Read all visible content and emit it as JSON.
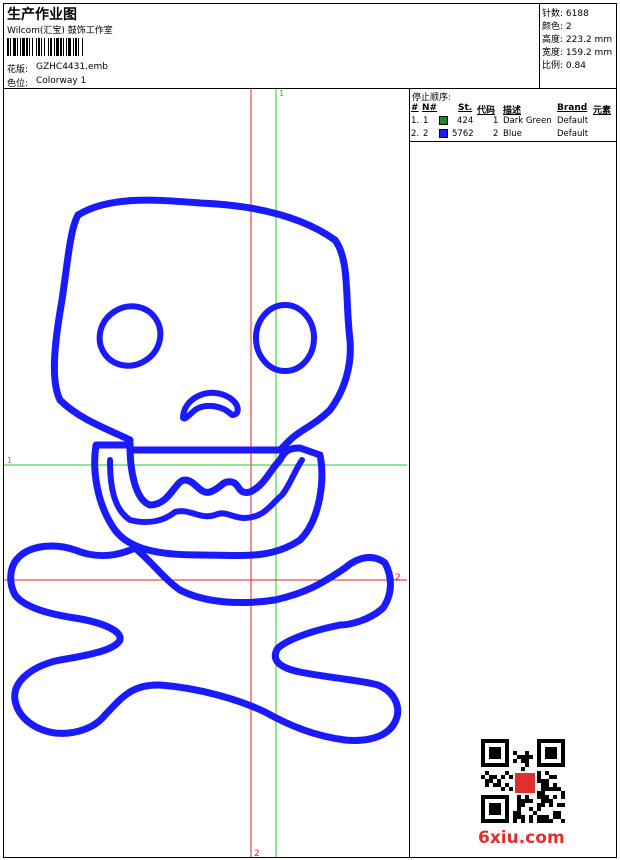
{
  "header": {
    "title": "生产作业图",
    "company": "Wilcom(汇宝) 鼓饰工作室",
    "design_label": "花版:",
    "design_value": "GZHC4431.emb",
    "colorway_label": "色位:",
    "colorway_value": "Colorway 1"
  },
  "info": {
    "stitches_label": "针数:",
    "stitches_value": "6188",
    "colors_label": "颜色:",
    "colors_value": "2",
    "height_label": "高度:",
    "height_value": "223.2 mm",
    "width_label": "宽度:",
    "width_value": "159.2 mm",
    "scale_label": "比例:",
    "scale_value": "0.84"
  },
  "stop_sequence": {
    "title": "停止顺序:",
    "columns": [
      "#",
      "N#",
      "St.",
      "代码",
      "描述",
      "Brand",
      "元素"
    ],
    "rows": [
      {
        "idx": "1.",
        "n": "1",
        "color": "#1a8a1a",
        "stitches": "424",
        "code": "1",
        "desc": "Dark Green",
        "brand": "Default"
      },
      {
        "idx": "2.",
        "n": "2",
        "color": "#1a1aff",
        "stitches": "5762",
        "code": "2",
        "desc": "Blue",
        "brand": "Default"
      }
    ]
  },
  "crosshair": {
    "green_h_label": "1",
    "green_v_label": "1",
    "red_h_label": "2",
    "red_v_label": "2"
  },
  "colors": {
    "stitch_blue": "#1a1aff",
    "guide_green": "#22cc22",
    "guide_red": "#dd2222"
  },
  "watermark": {
    "text": "6xiu.com"
  }
}
